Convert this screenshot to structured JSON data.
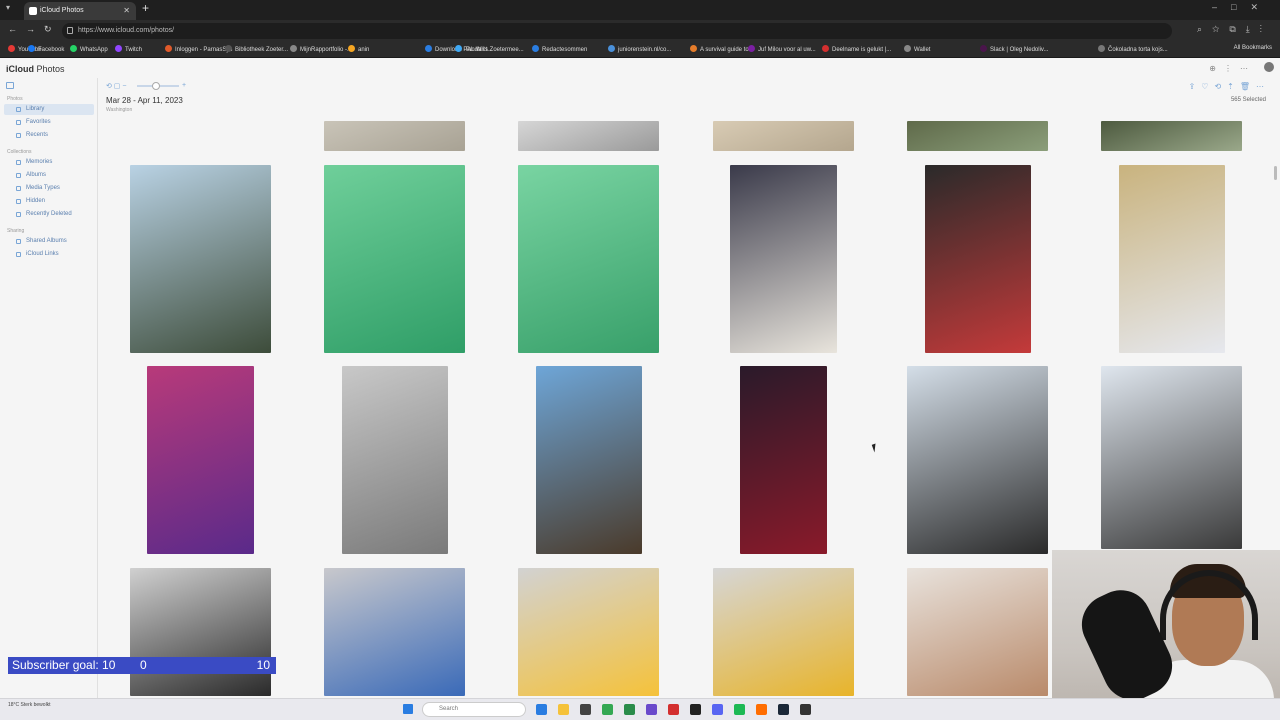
{
  "browser": {
    "tab_title": "iCloud Photos",
    "url": "https://www.icloud.com/photos/",
    "bookmarks": [
      {
        "label": "YouTube",
        "color": "#e53935"
      },
      {
        "label": "Facebook",
        "color": "#1877f2"
      },
      {
        "label": "WhatsApp",
        "color": "#25d366"
      },
      {
        "label": "Twitch",
        "color": "#9146ff"
      },
      {
        "label": "Inloggen - ParnasSys",
        "color": "#e05a2a"
      },
      {
        "label": "Bibliotheek Zoeter...",
        "color": "#555555"
      },
      {
        "label": "MijnRapportfolio -...",
        "color": "#888888"
      },
      {
        "label": "anin",
        "color": "#f5a623"
      },
      {
        "label": "Download PAL Wii t...",
        "color": "#2a7de1"
      },
      {
        "label": "Tandarts Zoetermee...",
        "color": "#3fa9f5"
      },
      {
        "label": "Redactesommen",
        "color": "#2a7de1"
      },
      {
        "label": "juniorenstein.nl/co...",
        "color": "#4a90d9"
      },
      {
        "label": "A survival guide to...",
        "color": "#e57c2a"
      },
      {
        "label": "Juf Milou voor al uw...",
        "color": "#7b1fa2"
      },
      {
        "label": "Deelname is gelukt |...",
        "color": "#d32f2f"
      },
      {
        "label": "Wallet",
        "color": "#888888"
      },
      {
        "label": "Slack | Oleg Nedoliv...",
        "color": "#4a154b"
      },
      {
        "label": "Čokoladna torta kojs...",
        "color": "#777777"
      }
    ],
    "all_bookmarks": "All Bookmarks"
  },
  "app": {
    "brand": "iCloud",
    "title": "Photos",
    "sidebar": {
      "sections": [
        {
          "heading": "Photos",
          "items": [
            {
              "label": "Library",
              "active": true
            },
            {
              "label": "Favorites",
              "active": false
            },
            {
              "label": "Recents",
              "active": false
            }
          ]
        },
        {
          "heading": "Collections",
          "items": [
            {
              "label": "Memories",
              "active": false
            },
            {
              "label": "Albums",
              "active": false
            },
            {
              "label": "Media Types",
              "active": false
            },
            {
              "label": "Hidden",
              "active": false
            },
            {
              "label": "Recently Deleted",
              "active": false
            }
          ]
        },
        {
          "heading": "Sharing",
          "items": [
            {
              "label": "Shared Albums",
              "active": false
            },
            {
              "label": "iCloud Links",
              "active": false
            }
          ]
        }
      ]
    },
    "date_range": "Mar 28 - Apr 11, 2023",
    "location": "Washington",
    "selected_count": "565 Selected"
  },
  "photos": [
    {
      "desc": "walkway top",
      "colors": [
        "#c9c4b8",
        "#a8a294"
      ]
    },
    {
      "desc": "white wall top",
      "colors": [
        "#d6d6d6",
        "#9a9a9a"
      ]
    },
    {
      "desc": "floor tiles top",
      "colors": [
        "#d8cbb4",
        "#b4a68e"
      ]
    },
    {
      "desc": "dark top",
      "colors": [
        "#5f6a4a",
        "#8b9e7a"
      ]
    },
    {
      "desc": "dark top 2",
      "colors": [
        "#4d5a3f",
        "#9aa88a"
      ]
    },
    {
      "desc": "river view",
      "colors": [
        "#b9d2e4",
        "#3d4c3a"
      ]
    },
    {
      "desc": "green bag",
      "colors": [
        "#6fcf9a",
        "#2f9e67"
      ]
    },
    {
      "desc": "green bag 2",
      "colors": [
        "#79d4a2",
        "#38a06a"
      ]
    },
    {
      "desc": "hoodies store",
      "colors": [
        "#3a3a4a",
        "#e8e4dc"
      ]
    },
    {
      "desc": "hoodies wall",
      "colors": [
        "#2a2a2a",
        "#c43a3a"
      ]
    },
    {
      "desc": "laptop screen",
      "colors": [
        "#c9b37e",
        "#e6e8ee"
      ]
    },
    {
      "desc": "takis shelf",
      "colors": [
        "#b83a7a",
        "#5a2a8a"
      ]
    },
    {
      "desc": "tv room",
      "colors": [
        "#c8c8c8",
        "#7a7a7a"
      ]
    },
    {
      "desc": "tv avatar",
      "colors": [
        "#6ea6d8",
        "#4a3a2a"
      ]
    },
    {
      "desc": "spotify dark",
      "colors": [
        "#2a1a2a",
        "#8a1a2a"
      ]
    },
    {
      "desc": "notes tray",
      "colors": [
        "#d4dee8",
        "#2a2a2a"
      ]
    },
    {
      "desc": "notes hand",
      "colors": [
        "#dfe6ee",
        "#3a3a3a"
      ]
    },
    {
      "desc": "food tray",
      "colors": [
        "#d0d0d0",
        "#2a2a2a"
      ]
    },
    {
      "desc": "cake tray",
      "colors": [
        "#c8c8cc",
        "#3a6ab8"
      ]
    },
    {
      "desc": "juice tray",
      "colors": [
        "#d2d2d2",
        "#f5c23a"
      ]
    },
    {
      "desc": "juice tray 2",
      "colors": [
        "#d6d6d6",
        "#e8b42a"
      ]
    },
    {
      "desc": "face selfie",
      "colors": [
        "#e8e2dc",
        "#b98a6a"
      ]
    }
  ],
  "overlay": {
    "subscriber_label": "Subscriber goal: 10",
    "current": "0",
    "goal": "10"
  },
  "taskbar": {
    "weather": "18°C Sterk bewolkt",
    "search_placeholder": "Search"
  }
}
